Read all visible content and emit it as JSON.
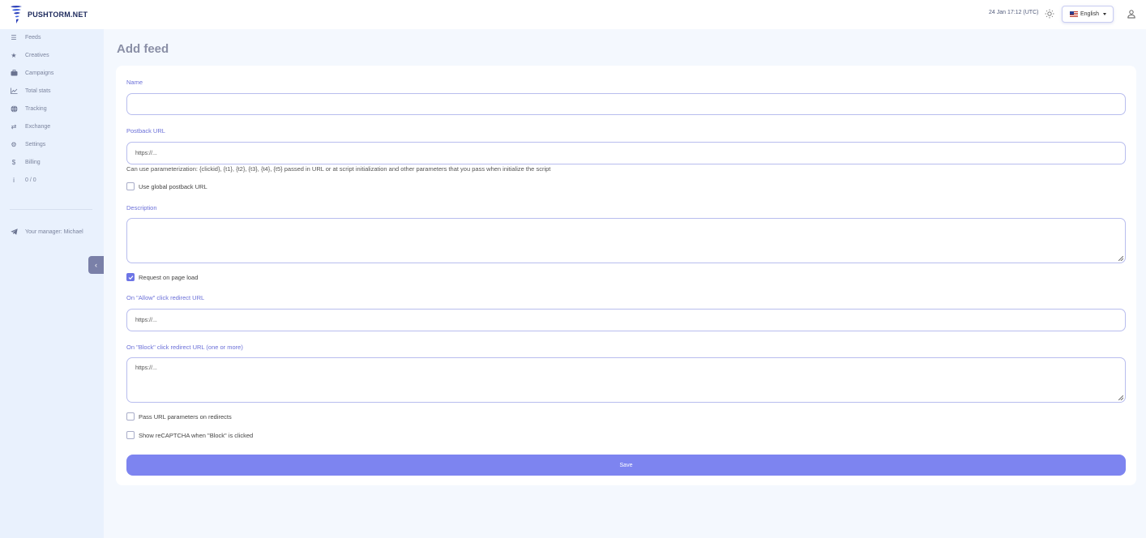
{
  "header": {
    "brand": "PUSHTORM.NET",
    "datetime": "24 Jan 17:12 (UTC)",
    "language": "English"
  },
  "sidebar": {
    "items": [
      {
        "label": "Feeds",
        "icon": "list-icon"
      },
      {
        "label": "Creatives",
        "icon": "star-icon"
      },
      {
        "label": "Campaigns",
        "icon": "briefcase-icon"
      },
      {
        "label": "Total stats",
        "icon": "chart-line-icon"
      },
      {
        "label": "Tracking",
        "icon": "globe-icon"
      },
      {
        "label": "Exchange",
        "icon": "exchange-icon"
      },
      {
        "label": "Settings",
        "icon": "gear-icon"
      },
      {
        "label": "Billing",
        "icon": "dollar-icon"
      },
      {
        "label": "0 / 0",
        "icon": "info-icon"
      }
    ],
    "manager": "Your manager: Michael"
  },
  "page": {
    "title": "Add feed"
  },
  "form": {
    "name_label": "Name",
    "name_value": "",
    "postback_label": "Postback URL",
    "postback_placeholder": "https://...",
    "postback_hint": "Can use parameterization: {clickid}, {t1}, {t2}, {t3}, {t4}, {t5} passed in URL or at script initialization and other parameters that you pass when initialize the script",
    "use_global_postback": {
      "label": "Use global postback URL",
      "checked": false
    },
    "description_label": "Description",
    "description_value": "",
    "request_on_load": {
      "label": "Request on page load",
      "checked": true
    },
    "allow_label": "On \"Allow\" click redirect URL",
    "allow_placeholder": "https://...",
    "block_label": "On \"Block\" click redirect URL (one or more)",
    "block_placeholder": "https://...",
    "pass_params": {
      "label": "Pass URL parameters on redirects",
      "checked": false
    },
    "show_recaptcha": {
      "label": "Show reCAPTCHA when \"Block\" is clicked",
      "checked": false
    },
    "save_label": "Save"
  },
  "colors": {
    "accent": "#7d84f0",
    "label": "#6b70d8",
    "sidebar_bg": "#e9f1fd",
    "page_bg": "#f4f8fe"
  }
}
